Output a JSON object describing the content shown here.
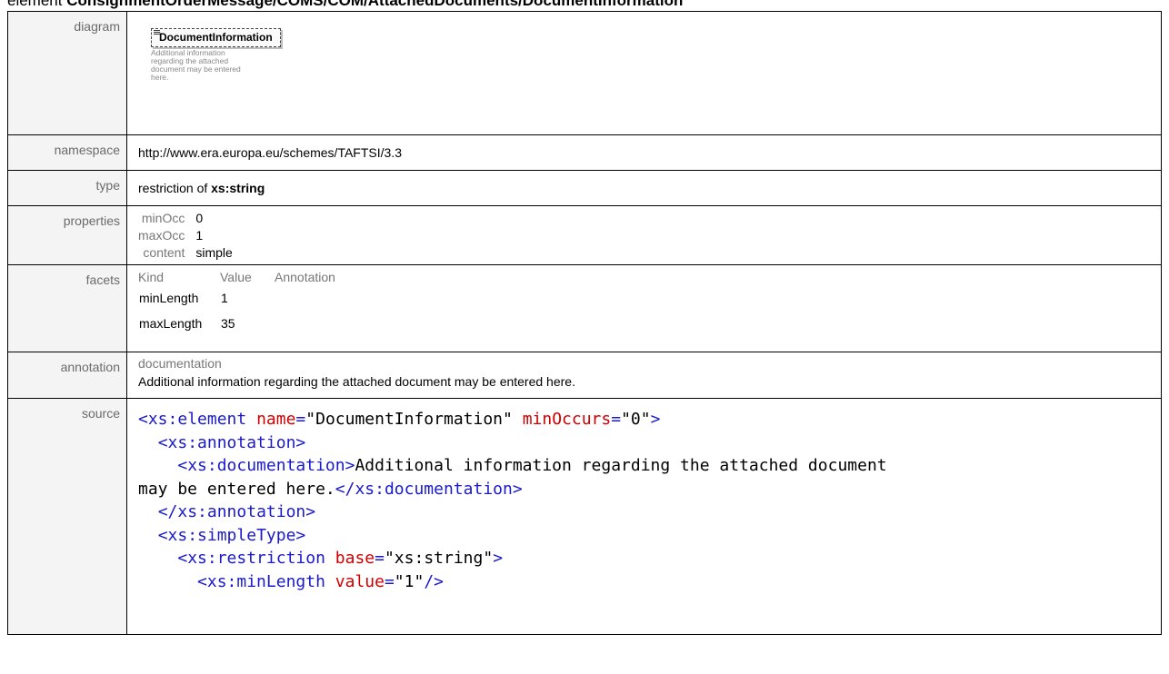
{
  "heading": {
    "prefix": "element ",
    "path": "ConsignmentOrderMessage/COMS/COM/AttachedDocuments/DocumentInformation"
  },
  "rows": {
    "diagram": {
      "label": "diagram",
      "box_title": "DocumentInformation",
      "note": "Additional information regarding the attached document may be entered here."
    },
    "namespace": {
      "label": "namespace",
      "value": "http://www.era.europa.eu/schemes/TAFTSI/3.3"
    },
    "type": {
      "label": "type",
      "prefix": "restriction of ",
      "base": "xs:string"
    },
    "properties": {
      "label": "properties",
      "items": [
        {
          "key": "minOcc",
          "value": "0"
        },
        {
          "key": "maxOcc",
          "value": "1"
        },
        {
          "key": "content",
          "value": "simple"
        }
      ]
    },
    "facets": {
      "label": "facets",
      "headers": [
        "Kind",
        "Value",
        "Annotation"
      ],
      "items": [
        {
          "kind": "minLength",
          "value": "1",
          "annotation": ""
        },
        {
          "kind": "maxLength",
          "value": "35",
          "annotation": ""
        }
      ]
    },
    "annotation": {
      "label": "annotation",
      "heading": "documentation",
      "text": "Additional information regarding the attached document may be entered here."
    },
    "source": {
      "label": "source",
      "element_open_tag": "xs:element",
      "name_attr": "name",
      "name_value": "\"DocumentInformation\"",
      "minoccurs_attr": "minOccurs",
      "minoccurs_value": "\"0\"",
      "annotation_tag": "xs:annotation",
      "documentation_tag": "xs:documentation",
      "documentation_text_1": "Additional information regarding the attached document",
      "documentation_text_2": "may be entered here.",
      "simpletype_tag": "xs:simpleType",
      "restriction_tag": "xs:restriction",
      "base_attr": "base",
      "base_value": "\"xs:string\"",
      "minlength_tag": "xs:minLength",
      "value_attr": "value",
      "minlength_value": "\"1\""
    }
  }
}
